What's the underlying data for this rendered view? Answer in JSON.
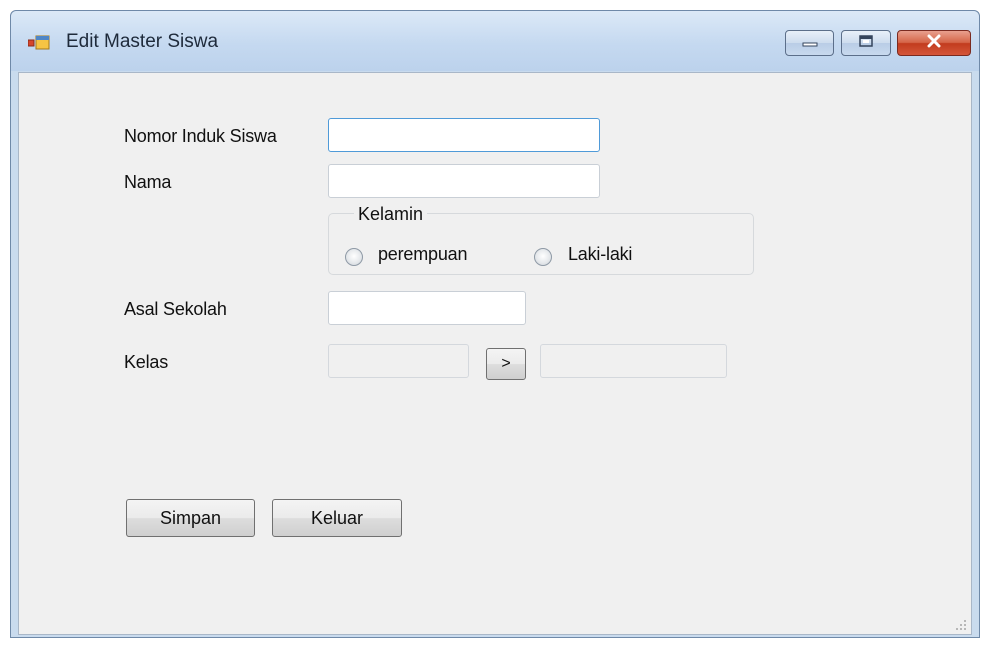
{
  "window": {
    "title": "Edit Master Siswa",
    "icon": "form-icon",
    "controls": [
      "minimize-icon",
      "maximize-icon",
      "close-icon"
    ]
  },
  "form": {
    "nis_label": "Nomor Induk Siswa",
    "nis_value": "",
    "nama_label": "Nama",
    "nama_value": "",
    "gender_group": {
      "title": "Kelamin",
      "options": [
        "perempuan",
        "Laki-laki"
      ],
      "selected": null
    },
    "asal_label": "Asal Sekolah",
    "asal_value": "",
    "kelas_label": "Kelas",
    "kelas_code_value": "",
    "kelas_pick_label": ">",
    "kelas_name_value": ""
  },
  "buttons": {
    "save_label": "Simpan",
    "exit_label": "Keluar"
  },
  "colors": {
    "titlebar": "#c5d9f0",
    "client": "#f0f0f0",
    "close_button": "#c23c1e",
    "focus_border": "#4f9ad8"
  }
}
